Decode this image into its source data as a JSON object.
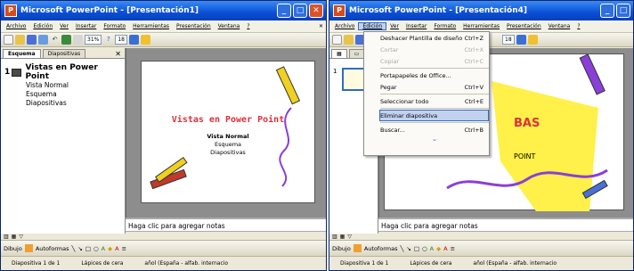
{
  "left": {
    "title": "Microsoft PowerPoint - [Presentación1]",
    "menu": [
      "Archivo",
      "Edición",
      "Ver",
      "Insertar",
      "Formato",
      "Herramientas",
      "Presentación",
      "Ventana",
      "?"
    ],
    "zoom": "31%",
    "font_size": "18",
    "tabs": [
      "Esquema",
      "Diapositivas"
    ],
    "outline": {
      "num": "1",
      "title": "Vistas en Power Point",
      "bullets": [
        "Vista Normal",
        "Esquema",
        "Diapositivas"
      ]
    },
    "slide": {
      "title": "Vistas en Power Point",
      "bullets": [
        "Vista Normal",
        "Esquema",
        "Diapositivas"
      ]
    },
    "notes": "Haga clic para agregar notas",
    "draw_label": "Dibujo",
    "autoshapes": "Autoformas",
    "status": [
      "Diapositiva 1 de 1",
      "Lápices de cera",
      "añol (España - alfab. internacio"
    ]
  },
  "right": {
    "title": "Microsoft PowerPoint - [Presentación4]",
    "menu": [
      "Archivo",
      "Edición",
      "Ver",
      "Insertar",
      "Formato",
      "Herramientas",
      "Presentación",
      "Ventana",
      "?"
    ],
    "font_size": "18",
    "dropdown": [
      {
        "label": "Deshacer Plantilla de diseño",
        "shortcut": "Ctrl+Z",
        "disabled": false
      },
      {
        "label": "Cortar",
        "shortcut": "Ctrl+X",
        "disabled": true
      },
      {
        "label": "Copiar",
        "shortcut": "Ctrl+C",
        "disabled": true
      },
      {
        "label": "Portapapeles de Office...",
        "shortcut": "",
        "disabled": false
      },
      {
        "label": "Pegar",
        "shortcut": "Ctrl+V",
        "disabled": false
      },
      {
        "label": "Seleccionar todo",
        "shortcut": "Ctrl+E",
        "disabled": false
      },
      {
        "label": "Eliminar diapositiva",
        "shortcut": "",
        "disabled": false,
        "highlight": true
      },
      {
        "label": "Buscar...",
        "shortcut": "Ctrl+B",
        "disabled": false
      }
    ],
    "slide_fragments": [
      "BAS",
      "POINT"
    ],
    "thumb_num": "1",
    "notes": "Haga clic para agregar notas",
    "draw_label": "Dibujo",
    "autoshapes": "Autoformas",
    "status": [
      "Diapositiva 1 de 1",
      "Lápices de cera",
      "añol (España - alfab. internacio"
    ]
  },
  "colors": {
    "title_red": "#e0303a",
    "sticky_yellow": "#fff04a",
    "crayon_purple": "#8a3fd8"
  }
}
